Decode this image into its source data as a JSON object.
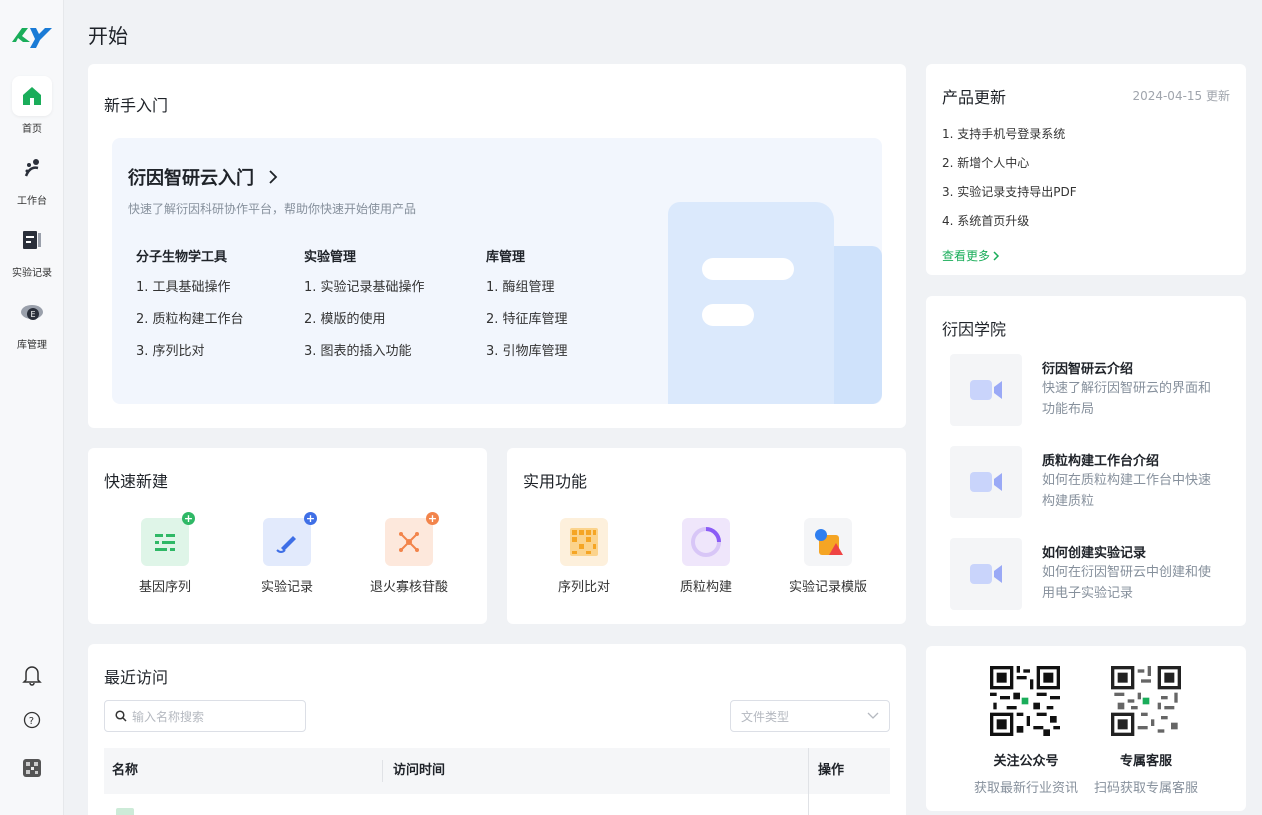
{
  "app": {
    "logo_text": "KY",
    "brand_color": "#1aad5a"
  },
  "sidebar": {
    "items": [
      {
        "label": "首页",
        "icon": "home-icon"
      },
      {
        "label": "工作台",
        "icon": "workbench-icon"
      },
      {
        "label": "实验记录",
        "icon": "notebook-icon"
      },
      {
        "label": "库管理",
        "icon": "database-icon"
      }
    ],
    "bottom": [
      "bell-icon",
      "help-icon",
      "avatar"
    ]
  },
  "header": {
    "title": "开始"
  },
  "getting_started": {
    "title": "新手入门",
    "banner_title": "衍因智研云入门",
    "banner_sub": "快速了解衍因科研协作平台，帮助你快速开始使用产品",
    "columns": [
      {
        "head": "分子生物学工具",
        "items": [
          "1. 工具基础操作",
          "2. 质粒构建工作台",
          "3. 序列比对"
        ]
      },
      {
        "head": "实验管理",
        "items": [
          "1. 实验记录基础操作",
          "2. 模版的使用",
          "3. 图表的插入功能"
        ]
      },
      {
        "head": "库管理",
        "items": [
          "1. 酶组管理",
          "2. 特征库管理",
          "3. 引物库管理"
        ]
      }
    ]
  },
  "quick_create": {
    "title": "快速新建",
    "tiles": [
      {
        "label": "基因序列",
        "icon": "gene-sequence-icon",
        "color": "#2fb866"
      },
      {
        "label": "实验记录",
        "icon": "experiment-record-icon",
        "color": "#3f6fe6"
      },
      {
        "label": "退火寡核苷酸",
        "icon": "oligo-icon",
        "color": "#f2844b"
      }
    ]
  },
  "useful": {
    "title": "实用功能",
    "tiles": [
      {
        "label": "序列比对",
        "icon": "alignment-icon"
      },
      {
        "label": "质粒构建",
        "icon": "plasmid-icon"
      },
      {
        "label": "实验记录模版",
        "icon": "template-icon"
      }
    ]
  },
  "recent": {
    "title": "最近访问",
    "search_placeholder": "输入名称搜索",
    "filter_placeholder": "文件类型",
    "columns": [
      "名称",
      "访问时间",
      "操作"
    ]
  },
  "updates": {
    "title": "产品更新",
    "date": "2024-04-15 更新",
    "items": [
      "1. 支持手机号登录系统",
      "2. 新增个人中心",
      "3. 实验记录支持导出PDF",
      "4. 系统首页升级"
    ],
    "more": "查看更多"
  },
  "academy": {
    "title": "衍因学院",
    "courses": [
      {
        "title": "衍因智研云介绍",
        "desc": "快速了解衍因智研云的界面和功能布局"
      },
      {
        "title": "质粒构建工作台介绍",
        "desc": "如何在质粒构建工作台中快速构建质粒"
      },
      {
        "title": "如何创建实验记录",
        "desc": "如何在衍因智研云中创建和使用电子实验记录"
      }
    ]
  },
  "contact": {
    "items": [
      {
        "label": "关注公众号",
        "sub": "获取最新行业资讯"
      },
      {
        "label": "专属客服",
        "sub": "扫码获取专属客服"
      }
    ]
  }
}
